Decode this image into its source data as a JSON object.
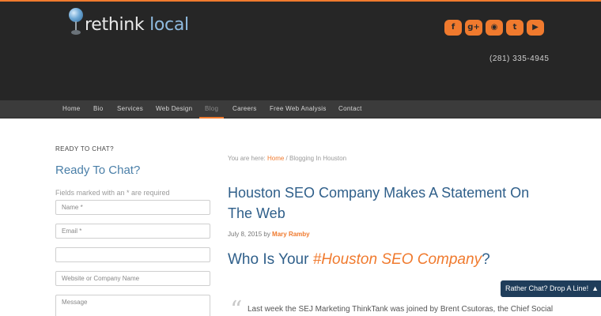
{
  "brand": {
    "word1": "rethink",
    "word2": "local"
  },
  "social": [
    {
      "icon": "facebook-icon",
      "glyph": "f"
    },
    {
      "icon": "google-plus-icon",
      "glyph": "g+"
    },
    {
      "icon": "rss-icon",
      "glyph": "◉"
    },
    {
      "icon": "twitter-icon",
      "glyph": "t"
    },
    {
      "icon": "youtube-icon",
      "glyph": "▶"
    }
  ],
  "phone": "(281) 335-4945",
  "nav": [
    {
      "label": "Home",
      "active": false
    },
    {
      "label": "Bio",
      "active": false
    },
    {
      "label": "Services",
      "active": false
    },
    {
      "label": "Web Design",
      "active": false
    },
    {
      "label": "Blog",
      "active": true
    },
    {
      "label": "Careers",
      "active": false
    },
    {
      "label": "Free Web Analysis",
      "active": false
    },
    {
      "label": "Contact",
      "active": false
    }
  ],
  "sidebar": {
    "label": "READY TO CHAT?",
    "title": "Ready To Chat?",
    "fields_note": "Fields marked with an * are required",
    "fields": [
      {
        "placeholder": "Name *"
      },
      {
        "placeholder": "Email *"
      },
      {
        "placeholder": ""
      },
      {
        "placeholder": "Website or Company Name"
      },
      {
        "placeholder": "Message"
      }
    ]
  },
  "breadcrumb": {
    "prefix": "You are here: ",
    "home": "Home",
    "sep": " / ",
    "current": "Blogging In Houston"
  },
  "post": {
    "title": "Houston SEO Company Makes A Statement On The Web",
    "date": "July 8, 2015",
    "by": " by ",
    "author": "Mary Ramby",
    "subtitle_pre": "Who Is Your ",
    "subtitle_hl": "#Houston SEO Company",
    "subtitle_post": "?",
    "quote_mark": "“",
    "body_start": "Last week the SEJ Marketing ThinkTank was joined by Brent Csutoras, the Chief Social"
  },
  "chat": {
    "label": "Rather Chat? Drop A Line!",
    "icon": "chevron-up-icon"
  },
  "colors": {
    "accent": "#f07a2e",
    "header_bg": "#262626",
    "nav_bg": "#3b3b3b",
    "heading_blue": "#2f5f8a"
  }
}
